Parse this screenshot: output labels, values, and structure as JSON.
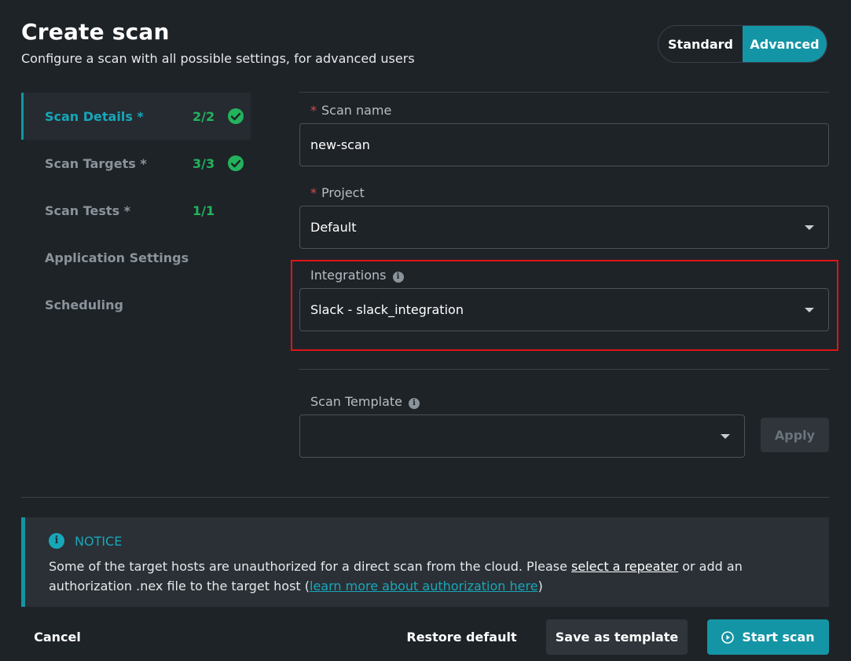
{
  "header": {
    "title": "Create scan",
    "subtitle": "Configure a scan with all possible settings, for advanced users",
    "mode_toggle": {
      "options": [
        "Standard",
        "Advanced"
      ],
      "selected": "Advanced"
    }
  },
  "sidebar": {
    "items": [
      {
        "label": "Scan Details *",
        "count": "2/2",
        "complete": true,
        "active": true
      },
      {
        "label": "Scan Targets *",
        "count": "3/3",
        "complete": true,
        "active": false
      },
      {
        "label": "Scan Tests *",
        "count": "1/1",
        "complete": false,
        "active": false
      },
      {
        "label": "Application Settings",
        "count": "",
        "complete": false,
        "active": false
      },
      {
        "label": "Scheduling",
        "count": "",
        "complete": false,
        "active": false
      }
    ]
  },
  "form": {
    "scan_name": {
      "required_mark": "*",
      "label": "Scan name",
      "value": "new-scan"
    },
    "project": {
      "required_mark": "*",
      "label": "Project",
      "value": "Default"
    },
    "integrations": {
      "label": "Integrations",
      "info_icon": "info-icon",
      "value": "Slack - slack_integration"
    },
    "scan_template": {
      "label": "Scan Template",
      "info_icon": "info-icon",
      "value": "",
      "apply_label": "Apply"
    }
  },
  "notice": {
    "title": "NOTICE",
    "text_part1": "Some of the target hosts are unauthorized for a direct scan from the cloud. Please ",
    "link1": "select a repeater",
    "text_part2": " or add an authorization .nex file to the target host (",
    "link2": "learn more about authorization here",
    "text_part3": ")"
  },
  "footer": {
    "cancel_label": "Cancel",
    "restore_label": "Restore default",
    "save_template_label": "Save as template",
    "start_scan_label": "Start scan"
  },
  "colors": {
    "accent": "#1495a5",
    "success": "#23b35c",
    "highlight_border": "#e01515",
    "required": "#e04848",
    "background": "#1e2328"
  }
}
